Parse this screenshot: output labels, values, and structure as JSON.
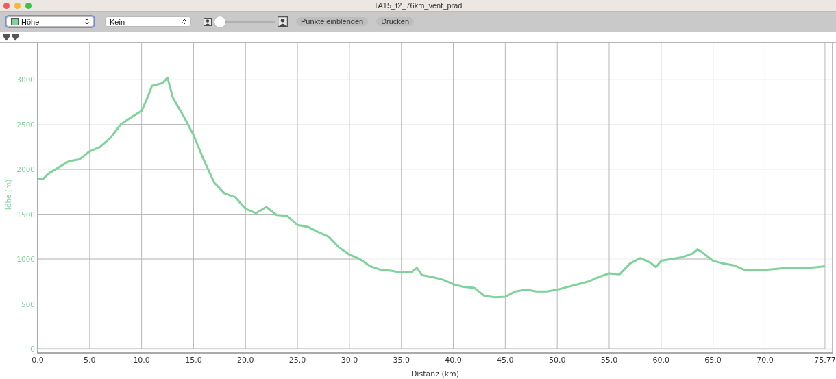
{
  "window": {
    "title": "TA15_t2_76km_vent_prad"
  },
  "toolbar": {
    "series_select": {
      "value": "Höhe",
      "color": "#7fd39a",
      "focused": true
    },
    "overlay_select": {
      "value": "Kein",
      "focused": false
    },
    "zoom_slider": {
      "level": 0
    },
    "buttons": [
      "Punkte einblenden",
      "Drucken"
    ]
  },
  "chart": {
    "chart_data": {
      "type": "line",
      "xlabel": "Distanz (km)",
      "ylabel": "Höhe (m)",
      "x": [
        0,
        0.5,
        1,
        2,
        3,
        4,
        5,
        6,
        7,
        8,
        9,
        10,
        10.5,
        11,
        12,
        12.5,
        13,
        14,
        15,
        16,
        17,
        18,
        19,
        20,
        21,
        22,
        23,
        24,
        25,
        26,
        27,
        28,
        29,
        30,
        31,
        32,
        33,
        34,
        35,
        36,
        36.5,
        37,
        38,
        39,
        40,
        41,
        42,
        43,
        44,
        45,
        46,
        47,
        48,
        49,
        50,
        51,
        52,
        53,
        54,
        55,
        56,
        57,
        58,
        59,
        59.5,
        60,
        61,
        62,
        63,
        63.5,
        64,
        65,
        66,
        67,
        68,
        69,
        70,
        71,
        72,
        73,
        74,
        75,
        75.77
      ],
      "series": [
        {
          "color": "#7fd39a",
          "values": [
            1900,
            1890,
            1950,
            2020,
            2090,
            2110,
            2200,
            2250,
            2350,
            2500,
            2580,
            2650,
            2780,
            2930,
            2960,
            3020,
            2800,
            2600,
            2380,
            2100,
            1850,
            1730,
            1690,
            1560,
            1510,
            1580,
            1490,
            1480,
            1380,
            1360,
            1300,
            1250,
            1130,
            1050,
            1000,
            920,
            880,
            870,
            850,
            860,
            900,
            820,
            800,
            770,
            720,
            690,
            680,
            590,
            575,
            580,
            640,
            660,
            640,
            640,
            660,
            690,
            720,
            750,
            800,
            840,
            830,
            950,
            1010,
            960,
            910,
            980,
            1000,
            1020,
            1060,
            1110,
            1070,
            980,
            950,
            930,
            880,
            880,
            880,
            890,
            900,
            900,
            900,
            910,
            920
          ]
        }
      ],
      "grid": true,
      "xlim": [
        0,
        76.5
      ],
      "ylim": [
        0,
        3405
      ],
      "xticks": [
        {
          "value": 0,
          "label": "0.0"
        },
        {
          "value": 5,
          "label": "5.0"
        },
        {
          "value": 10,
          "label": "10.0"
        },
        {
          "value": 15,
          "label": "15.0"
        },
        {
          "value": 20,
          "label": "20.0"
        },
        {
          "value": 25,
          "label": "25.0"
        },
        {
          "value": 30,
          "label": "30.0"
        },
        {
          "value": 35,
          "label": "35.0"
        },
        {
          "value": 40,
          "label": "40.0"
        },
        {
          "value": 45,
          "label": "45.0"
        },
        {
          "value": 50,
          "label": "50.0"
        },
        {
          "value": 55,
          "label": "55.0"
        },
        {
          "value": 60,
          "label": "60.0"
        },
        {
          "value": 65,
          "label": "65.0"
        },
        {
          "value": 70,
          "label": "70.0"
        },
        {
          "value": 75.77,
          "label": "75.77"
        }
      ],
      "yticks": [
        0,
        500,
        1000,
        1500,
        2000,
        2500,
        3000
      ]
    }
  }
}
